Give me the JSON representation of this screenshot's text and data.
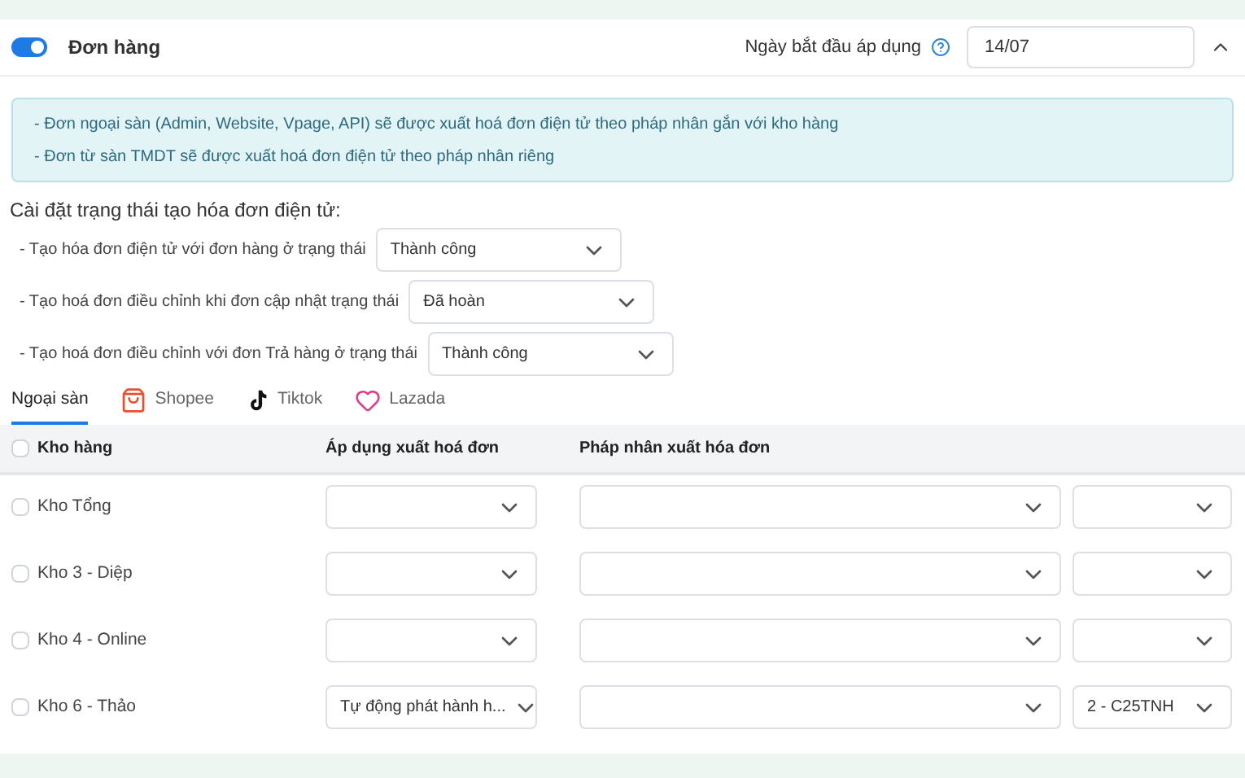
{
  "section": {
    "title": "Đơn hàng",
    "enabled": true,
    "expanded": true,
    "start_date": {
      "label": "Ngày bắt đầu áp dụng",
      "value": "14/07"
    }
  },
  "notice": [
    "- Đơn ngoại sàn (Admin, Website, Vpage, API) sẽ được xuất hoá đơn điện tử theo pháp nhân gắn với kho hàng",
    "- Đơn từ sàn TMDT sẽ được xuất hoá đơn điện tử theo pháp nhân riêng"
  ],
  "status_settings": {
    "title": "Cài đặt trạng thái tạo hóa đơn điện tử:",
    "rows": [
      {
        "label": "- Tạo hóa đơn điện tử với đơn hàng ở trạng thái",
        "value": "Thành công"
      },
      {
        "label": "- Tạo hoá đơn điều chỉnh khi đơn cập nhật trạng thái",
        "value": "Đã hoàn"
      },
      {
        "label": "- Tạo hoá đơn điều chỉnh với đơn Trả hàng ở trạng thái",
        "value": "Thành công"
      }
    ]
  },
  "tabs": [
    {
      "label": "Ngoại sàn",
      "kind": "plain",
      "selected": true
    },
    {
      "label": "Shopee",
      "kind": "shopee",
      "selected": false
    },
    {
      "label": "Tiktok",
      "kind": "tiktok",
      "selected": false
    },
    {
      "label": "Lazada",
      "kind": "lazada",
      "selected": false
    }
  ],
  "table": {
    "columns": [
      "Kho hàng",
      "Áp dụng xuất hoá đơn",
      "Pháp nhân xuất hóa đơn"
    ],
    "all_checked": false,
    "rows": [
      {
        "name": "Kho Tổng",
        "checked": false,
        "apply": "",
        "entity": "",
        "code": ""
      },
      {
        "name": "Kho 3 - Diệp",
        "checked": false,
        "apply": "",
        "entity": "",
        "code": ""
      },
      {
        "name": "Kho 4 - Online",
        "checked": false,
        "apply": "",
        "entity": "",
        "code": ""
      },
      {
        "name": "Kho 6 - Thảo",
        "checked": false,
        "apply": "Tự động phát hành h...",
        "entity": "",
        "code": "2 - C25TNH"
      }
    ]
  }
}
